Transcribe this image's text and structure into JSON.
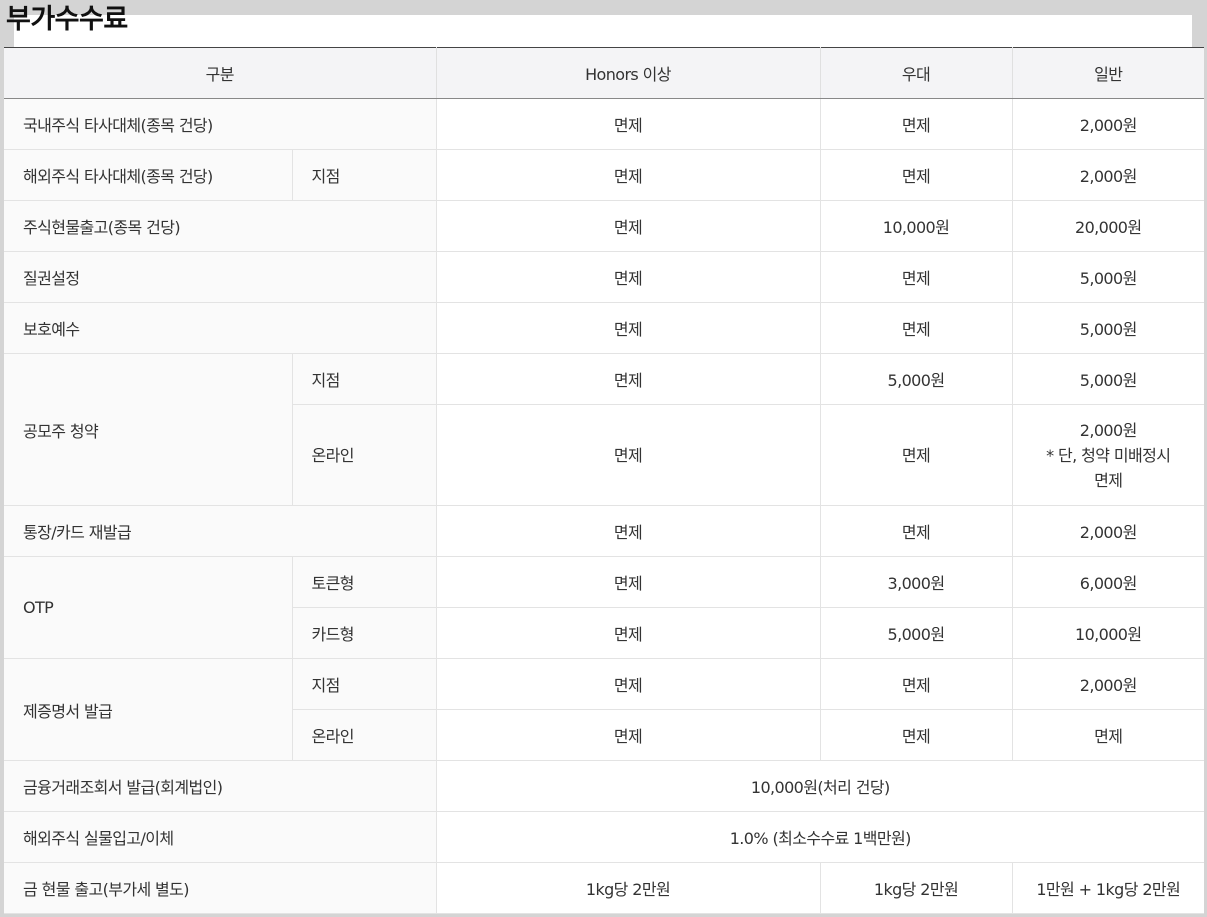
{
  "title": "부가수수료",
  "headers": [
    "구분",
    "Honors 이상",
    "우대",
    "일반"
  ],
  "rows": {
    "domestic_transfer": {
      "label": "국내주식 타사대체(종목 건당)",
      "honors": "면제",
      "preferred": "면제",
      "general": "2,000원"
    },
    "overseas_transfer": {
      "label": "해외주식 타사대체(종목 건당)",
      "sub": "지점",
      "honors": "면제",
      "preferred": "면제",
      "general": "2,000원"
    },
    "stock_withdrawal": {
      "label": "주식현물출고(종목 건당)",
      "honors": "면제",
      "preferred": "10,000원",
      "general": "20,000원"
    },
    "pledge": {
      "label": "질권설정",
      "honors": "면제",
      "preferred": "면제",
      "general": "5,000원"
    },
    "custody": {
      "label": "보호예수",
      "honors": "면제",
      "preferred": "면제",
      "general": "5,000원"
    },
    "ipo": {
      "label": "공모주 청약",
      "branch": {
        "sub": "지점",
        "honors": "면제",
        "preferred": "5,000원",
        "general": "5,000원"
      },
      "online": {
        "sub": "온라인",
        "honors": "면제",
        "preferred": "면제",
        "general_lines": [
          "2,000원",
          "* 단, 청약 미배정시",
          "면제"
        ]
      }
    },
    "reissue": {
      "label": "통장/카드 재발급",
      "honors": "면제",
      "preferred": "면제",
      "general": "2,000원"
    },
    "otp": {
      "label": "OTP",
      "token": {
        "sub": "토큰형",
        "honors": "면제",
        "preferred": "3,000원",
        "general": "6,000원"
      },
      "card": {
        "sub": "카드형",
        "honors": "면제",
        "preferred": "5,000원",
        "general": "10,000원"
      }
    },
    "certificate": {
      "label": "제증명서 발급",
      "branch": {
        "sub": "지점",
        "honors": "면제",
        "preferred": "면제",
        "general": "2,000원"
      },
      "online": {
        "sub": "온라인",
        "honors": "면제",
        "preferred": "면제",
        "general": "면제"
      }
    },
    "financial_inquiry": {
      "label": "금융거래조회서 발급(회계법인)",
      "value": "10,000원(처리 건당)"
    },
    "overseas_physical": {
      "label": "해외주식 실물입고/이체",
      "value": "1.0% (최소수수료 1백만원)"
    },
    "gold": {
      "label": "금 현물 출고(부가세 별도)",
      "honors": "1kg당 2만원",
      "preferred": "1kg당 2만원",
      "general": "1만원 + 1kg당 2만원"
    }
  }
}
